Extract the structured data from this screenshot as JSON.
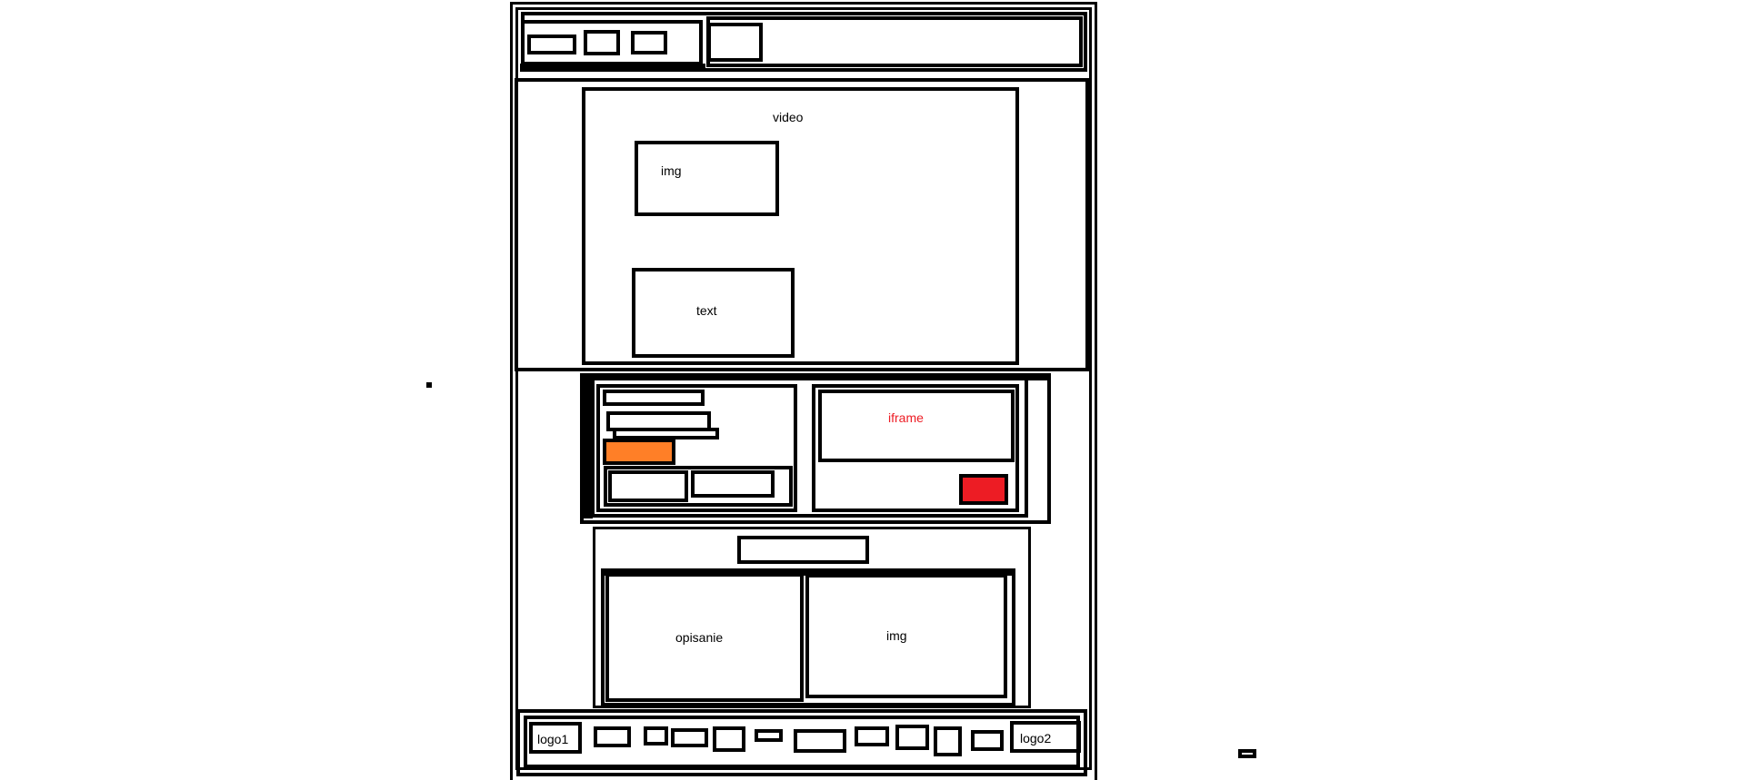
{
  "labels": {
    "video": "video",
    "hero_img": "img",
    "hero_text": "text",
    "iframe": "iframe",
    "opisanie": "opisanie",
    "img2": "img",
    "logo1": "logo1",
    "logo2": "logo2"
  },
  "colors": {
    "stroke": "#000000",
    "background": "#ffffff",
    "orange_block": "#ff7f27",
    "red_block": "#ed1c24",
    "iframe_label": "#ed1c24"
  }
}
